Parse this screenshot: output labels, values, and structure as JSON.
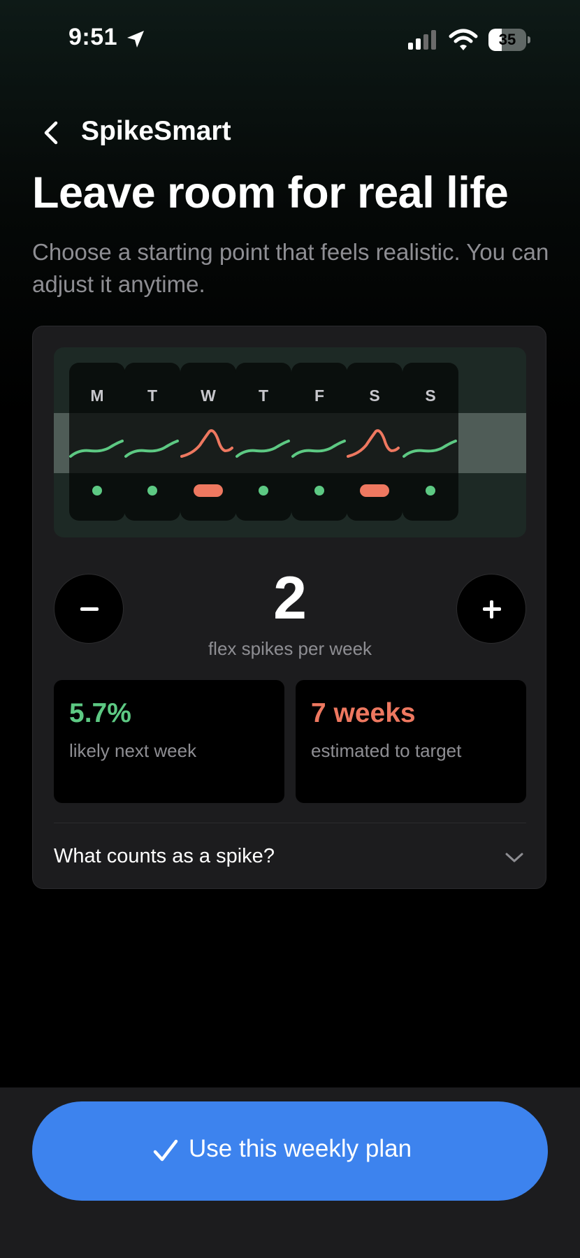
{
  "status_bar": {
    "time": "9:51",
    "battery_level": "35",
    "battery_fraction": 0.35,
    "icons": [
      "location-arrow-icon",
      "cellular-signal-icon",
      "wifi-icon",
      "battery-icon"
    ]
  },
  "nav": {
    "back_icon": "chevron-left-icon",
    "title": "SpikeSmart"
  },
  "header": {
    "title": "Leave room for real life",
    "subtitle": "Choose a starting point that feels realistic. You can adjust it anytime."
  },
  "week": {
    "days": [
      {
        "letter": "M",
        "type": "steady"
      },
      {
        "letter": "T",
        "type": "steady"
      },
      {
        "letter": "W",
        "type": "spike"
      },
      {
        "letter": "T",
        "type": "steady"
      },
      {
        "letter": "F",
        "type": "steady"
      },
      {
        "letter": "S",
        "type": "spike"
      },
      {
        "letter": "S",
        "type": "steady"
      }
    ],
    "colors": {
      "steady": "#5dc983",
      "spike": "#ee7860"
    }
  },
  "stepper": {
    "decrease_icon": "minus-icon",
    "increase_icon": "plus-icon",
    "value": "2",
    "label": "flex spikes per week"
  },
  "stats": {
    "left": {
      "value": "5.7%",
      "label": "likely next week",
      "color": "#5dc983"
    },
    "right": {
      "value": "7 weeks",
      "label": "estimated to target",
      "color": "#ee7860"
    }
  },
  "faq": {
    "label": "What counts as a spike?",
    "icon": "chevron-down-icon"
  },
  "cta": {
    "icon": "checkmark-icon",
    "label": "Use this weekly plan",
    "color": "#3d83ee"
  }
}
